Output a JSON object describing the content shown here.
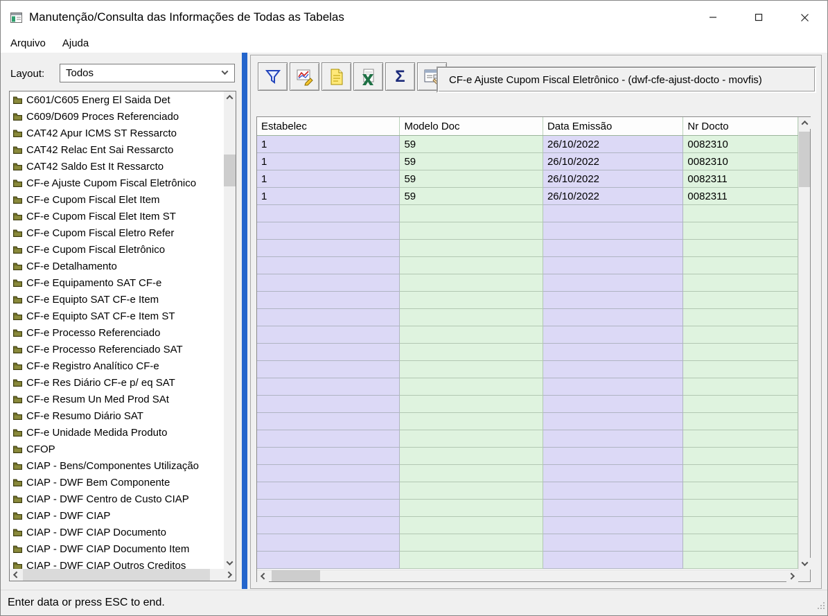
{
  "window": {
    "title": "Manutenção/Consulta das Informações de Todas as Tabelas"
  },
  "menu": {
    "items": [
      {
        "label": "Arquivo"
      },
      {
        "label": "Ajuda"
      }
    ]
  },
  "sidebar": {
    "layout_label": "Layout:",
    "layout_value": "Todos",
    "items": [
      "C601/C605 Energ El Saida Det",
      "C609/D609 Proces Referenciado",
      "CAT42 Apur ICMS ST Ressarcto",
      "CAT42 Relac Ent Sai Ressarcto",
      "CAT42 Saldo Est It Ressarcto",
      "CF-e Ajuste Cupom Fiscal Eletrônico",
      "CF-e Cupom Fiscal Elet Item",
      "CF-e Cupom Fiscal Elet Item ST",
      "CF-e Cupom Fiscal Eletro Refer",
      "CF-e Cupom Fiscal Eletrônico",
      "CF-e Detalhamento",
      "CF-e Equipamento SAT CF-e",
      "CF-e Equipto SAT CF-e Item",
      "CF-e Equipto SAT CF-e Item ST",
      "CF-e Processo Referenciado",
      "CF-e Processo Referenciado SAT",
      "CF-e Registro Analítico CF-e",
      "CF-e Res Diário CF-e p/ eq SAT",
      "CF-e Resum Un Med Prod SAt",
      "CF-e Resumo Diário SAT",
      "CF-e Unidade Medida Produto",
      "CFOP",
      "CIAP - Bens/Componentes Utilização",
      "CIAP - DWF Bem Componente",
      "CIAP - DWF Centro de Custo CIAP",
      "CIAP - DWF CIAP",
      "CIAP - DWF CIAP Documento",
      "CIAP - DWF CIAP Documento Item",
      "CIAP - DWF CIAP Outros Creditos"
    ]
  },
  "toolbar": {
    "title": "CF-e Ajuste Cupom Fiscal Eletrônico - (dwf-cfe-ajust-docto - movfis)",
    "buttons": [
      {
        "name": "filter-button",
        "icon": "funnel-icon"
      },
      {
        "name": "graph-button",
        "icon": "chart-pencil-icon"
      },
      {
        "name": "document-button",
        "icon": "yellow-document-icon"
      },
      {
        "name": "excel-export-button",
        "icon": "excel-icon"
      },
      {
        "name": "totals-button",
        "icon": "sigma-icon",
        "glyph": "Σ"
      },
      {
        "name": "properties-button",
        "icon": "form-properties-icon"
      }
    ]
  },
  "grid": {
    "columns": [
      "Estabelec",
      "Modelo Doc",
      "Data Emissão",
      "Nr Docto"
    ],
    "rows": [
      [
        "1",
        "59",
        "26/10/2022",
        "0082310"
      ],
      [
        "1",
        "59",
        "26/10/2022",
        "0082310"
      ],
      [
        "1",
        "59",
        "26/10/2022",
        "0082311"
      ],
      [
        "1",
        "59",
        "26/10/2022",
        "0082311"
      ]
    ],
    "empty_row_count": 21,
    "column_colors": [
      "#dcd9f6",
      "#dff3df",
      "#dcd9f6",
      "#dff3df"
    ]
  },
  "statusbar": {
    "text": "Enter data or press ESC to end."
  },
  "colors": {
    "splitter": "#2465cc",
    "grid_lavender": "#dcd9f6",
    "grid_green": "#dff3df",
    "folder": "#6e6e28"
  }
}
